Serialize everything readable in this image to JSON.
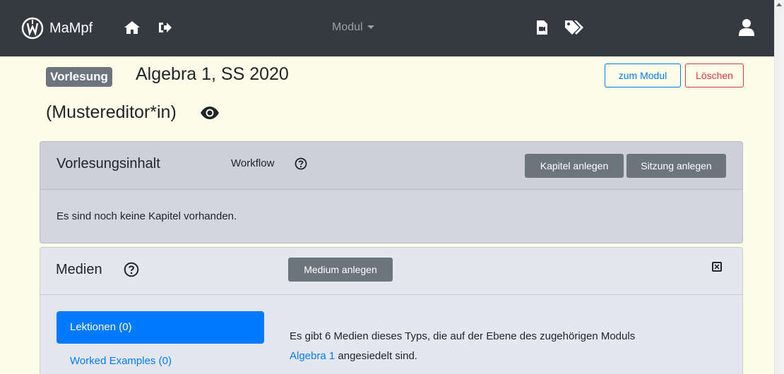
{
  "navbar": {
    "brand": "MaMpf",
    "modul_label": "Modul"
  },
  "header": {
    "badge": "Vorlesung",
    "title": "Algebra 1, SS 2020",
    "subtitle": "(Mustereditor*in)",
    "btn_zum_modul": "zum Modul",
    "btn_loeschen": "Löschen"
  },
  "vorlesungsinhalt": {
    "title": "Vorlesungsinhalt",
    "workflow_label": "Workflow",
    "btn_kapitel": "Kapitel anlegen",
    "btn_sitzung": "Sitzung anlegen",
    "body_text": "Es sind noch keine Kapitel vorhanden."
  },
  "medien": {
    "title": "Medien",
    "btn_medium": "Medium anlegen",
    "list": [
      {
        "label": "Lektionen (0)",
        "active": true
      },
      {
        "label": "Worked Examples (0)",
        "active": false
      }
    ],
    "info_prefix": "Es gibt 6 Medien dieses Typs, die auf der Ebene des zugehörigen Moduls",
    "info_link": "Algebra 1",
    "info_suffix": " angesiedelt sind."
  },
  "colors": {
    "navbar": "#343a40",
    "background": "#fcfce8",
    "primary": "#007bff",
    "danger": "#dc3545",
    "secondary": "#6c757d"
  },
  "icons": [
    "logo-icon",
    "home-icon",
    "logout-icon",
    "file-video-icon",
    "tags-icon",
    "user-icon",
    "eye-icon",
    "question-circle-icon",
    "close-box-icon"
  ]
}
